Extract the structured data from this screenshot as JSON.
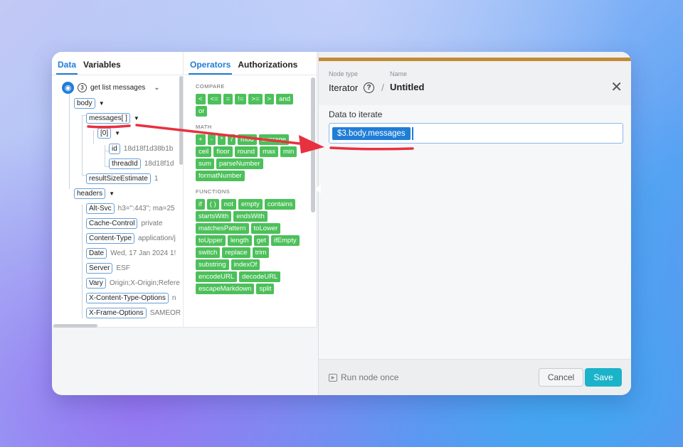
{
  "tools": {
    "left_tabs": [
      "Data",
      "Variables"
    ],
    "right_tabs": [
      "Operators",
      "Authorizations"
    ],
    "step": {
      "number": "3",
      "title": "get list messages"
    },
    "tree": {
      "body": "body",
      "messages": "messages[ ]",
      "index0": "[0]",
      "id": {
        "key": "id",
        "value": "18d18f1d38b1b"
      },
      "threadId": {
        "key": "threadId",
        "value": "18d18f1d"
      },
      "resultSizeEstimate": {
        "key": "resultSizeEstimate",
        "value": "1"
      },
      "headers": "headers",
      "header_items": [
        {
          "key": "Alt-Svc",
          "value": "h3=\":443\"; ma=25"
        },
        {
          "key": "Cache-Control",
          "value": "private"
        },
        {
          "key": "Content-Type",
          "value": "application/j"
        },
        {
          "key": "Date",
          "value": "Wed, 17 Jan 2024 1!"
        },
        {
          "key": "Server",
          "value": "ESF"
        },
        {
          "key": "Vary",
          "value": "Origin;X-Origin;Refere"
        },
        {
          "key": "X-Content-Type-Options",
          "value": "n"
        },
        {
          "key": "X-Frame-Options",
          "value": "SAMEOR"
        }
      ]
    },
    "operators": {
      "compare_label": "COMPARE",
      "compare": [
        "<",
        "<=",
        "=",
        "!=",
        ">=",
        ">",
        "and",
        "or"
      ],
      "math_label": "MATH",
      "math": [
        "+",
        "-",
        "*",
        "/",
        "mod",
        "average",
        "ceil",
        "floor",
        "round",
        "max",
        "min",
        "sum",
        "parseNumber",
        "formatNumber"
      ],
      "functions_label": "FUNCTIONS",
      "functions": [
        "if",
        "( )",
        "not",
        "empty",
        "contains",
        "startsWith",
        "endsWith",
        "matchesPattern",
        "toLower",
        "toUpper",
        "length",
        "get",
        "ifEmpty",
        "switch",
        "replace",
        "trim",
        "substring",
        "indexOf",
        "encodeURL",
        "decodeURL",
        "escapeMarkdown",
        "split"
      ]
    }
  },
  "panel": {
    "node_type_label": "Node type",
    "node_type": "Iterator",
    "name_label": "Name",
    "name": "Untitled",
    "field_label": "Data to iterate",
    "field_token": "$3.body.messages",
    "run_label": "Run node once",
    "cancel_label": "Cancel",
    "save_label": "Save"
  },
  "colors": {
    "accent": "#1f7ed6",
    "chip": "#4cc05a",
    "save": "#1bb3c9",
    "annotation": "#e8313f",
    "node_band": "#c28a34"
  }
}
